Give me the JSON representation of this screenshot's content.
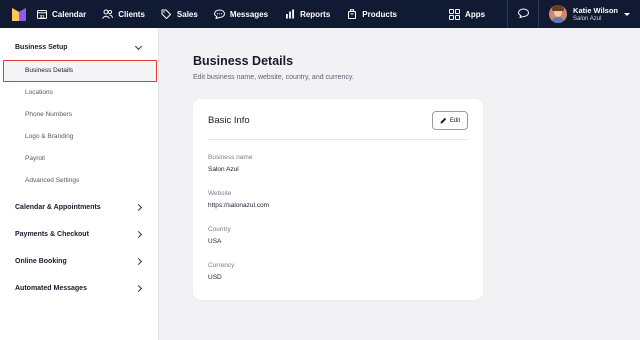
{
  "nav": {
    "items": [
      {
        "label": "Calendar",
        "icon": "calendar-icon"
      },
      {
        "label": "Clients",
        "icon": "clients-icon"
      },
      {
        "label": "Sales",
        "icon": "tag-icon"
      },
      {
        "label": "Messages",
        "icon": "chat-icon"
      },
      {
        "label": "Reports",
        "icon": "bar-chart-icon"
      },
      {
        "label": "Products",
        "icon": "box-icon"
      }
    ],
    "apps_label": "Apps",
    "user": {
      "name": "Katie Wilson",
      "salon": "Salon Azul"
    }
  },
  "sidebar": {
    "business_setup": "Business Setup",
    "sub_items": [
      "Business Details",
      "Locations",
      "Phone Numbers",
      "Logo & Branding",
      "Payroll",
      "Advanced Settings"
    ],
    "sections": [
      "Calendar & Appointments",
      "Payments & Checkout",
      "Online Booking",
      "Automated Messages"
    ]
  },
  "main": {
    "title": "Business Details",
    "subtitle": "Edit business name, website, country, and currency.",
    "card": {
      "title": "Basic Info",
      "edit_label": "Edit",
      "fields": [
        {
          "label": "Business name",
          "value": "Salon Azul"
        },
        {
          "label": "Website",
          "value": "https://salonazul.com"
        },
        {
          "label": "Country",
          "value": "USA"
        },
        {
          "label": "Currency",
          "value": "USD"
        }
      ]
    }
  },
  "colors": {
    "nav_bg": "#111a33",
    "active_outline": "#e23b2e",
    "page_bg": "#f2f2f4"
  }
}
